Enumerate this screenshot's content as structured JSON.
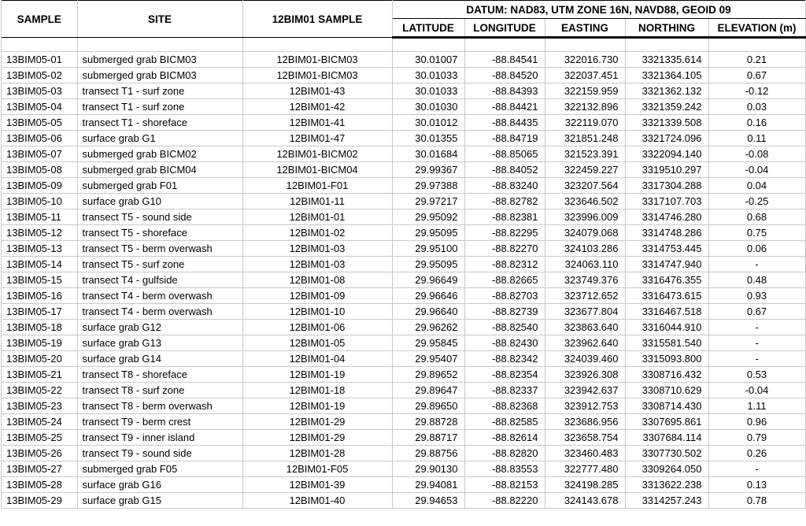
{
  "header": {
    "sample": "SAMPLE",
    "site": "SITE",
    "bim": "12BIM01 SAMPLE",
    "datum_group": "DATUM: NAD83, UTM ZONE 16N, NAVD88, GEOID 09",
    "lat": "LATITUDE",
    "lon": "LONGITUDE",
    "east": "EASTING",
    "north": "NORTHING",
    "elev": "ELEVATION (m)"
  },
  "rows": [
    {
      "sample": "13BIM05-01",
      "site": "submerged grab BICM03",
      "bim": "12BIM01-BICM03",
      "lat": "30.01007",
      "lon": "-88.84541",
      "east": "322016.730",
      "north": "3321335.614",
      "elev": "0.21"
    },
    {
      "sample": "13BIM05-02",
      "site": "submerged grab BICM03",
      "bim": "12BIM01-BICM03",
      "lat": "30.01033",
      "lon": "-88.84520",
      "east": "322037.451",
      "north": "3321364.105",
      "elev": "0.67"
    },
    {
      "sample": "13BIM05-03",
      "site": "transect T1 - surf zone",
      "bim": "12BIM01-43",
      "lat": "30.01033",
      "lon": "-88.84393",
      "east": "322159.959",
      "north": "3321362.132",
      "elev": "-0.12"
    },
    {
      "sample": "13BIM05-04",
      "site": "transect T1 - surf zone",
      "bim": "12BIM01-42",
      "lat": "30.01030",
      "lon": "-88.84421",
      "east": "322132.896",
      "north": "3321359.242",
      "elev": "0.03"
    },
    {
      "sample": "13BIM05-05",
      "site": "transect T1 - shoreface",
      "bim": "12BIM01-41",
      "lat": "30.01012",
      "lon": "-88.84435",
      "east": "322119.070",
      "north": "3321339.508",
      "elev": "0.16"
    },
    {
      "sample": "13BIM05-06",
      "site": "surface grab G1",
      "bim": "12BIM01-47",
      "lat": "30.01355",
      "lon": "-88.84719",
      "east": "321851.248",
      "north": "3321724.096",
      "elev": "0.11"
    },
    {
      "sample": "13BIM05-07",
      "site": "submerged grab BICM02",
      "bim": "12BIM01-BICM02",
      "lat": "30.01684",
      "lon": "-88.85065",
      "east": "321523.391",
      "north": "3322094.140",
      "elev": "-0.08"
    },
    {
      "sample": "13BIM05-08",
      "site": "submerged grab BICM04",
      "bim": "12BIM01-BICM04",
      "lat": "29.99367",
      "lon": "-88.84052",
      "east": "322459.227",
      "north": "3319510.297",
      "elev": "-0.04"
    },
    {
      "sample": "13BIM05-09",
      "site": "submerged grab F01",
      "bim": "12BIM01-F01",
      "lat": "29.97388",
      "lon": "-88.83240",
      "east": "323207.564",
      "north": "3317304.288",
      "elev": "0.04"
    },
    {
      "sample": "13BIM05-10",
      "site": "surface grab G10",
      "bim": "12BIM01-11",
      "lat": "29.97217",
      "lon": "-88.82782",
      "east": "323646.502",
      "north": "3317107.703",
      "elev": "-0.25"
    },
    {
      "sample": "13BIM05-11",
      "site": "transect T5 - sound side",
      "bim": "12BIM01-01",
      "lat": "29.95092",
      "lon": "-88.82381",
      "east": "323996.009",
      "north": "3314746.280",
      "elev": "0.68"
    },
    {
      "sample": "13BIM05-12",
      "site": "transect T5 - shoreface",
      "bim": "12BIM01-02",
      "lat": "29.95095",
      "lon": "-88.82295",
      "east": "324079.068",
      "north": "3314748.286",
      "elev": "0.75"
    },
    {
      "sample": "13BIM05-13",
      "site": "transect T5 - berm overwash",
      "bim": "12BIM01-03",
      "lat": "29.95100",
      "lon": "-88.82270",
      "east": "324103.286",
      "north": "3314753.445",
      "elev": "0.06"
    },
    {
      "sample": "13BIM05-14",
      "site": "transect T5 - surf zone",
      "bim": "12BIM01-03",
      "lat": "29.95095",
      "lon": "-88.82312",
      "east": "324063.110",
      "north": "3314747.940",
      "elev": "-"
    },
    {
      "sample": "13BIM05-15",
      "site": "transect T4 - gulfside",
      "bim": "12BIM01-08",
      "lat": "29.96649",
      "lon": "-88.82665",
      "east": "323749.376",
      "north": "3316476.355",
      "elev": "0.48"
    },
    {
      "sample": "13BIM05-16",
      "site": "transect T4 - berm overwash",
      "bim": "12BIM01-09",
      "lat": "29.96646",
      "lon": "-88.82703",
      "east": "323712.652",
      "north": "3316473.615",
      "elev": "0.93"
    },
    {
      "sample": "13BIM05-17",
      "site": "transect T4 - berm overwash",
      "bim": "12BIM01-10",
      "lat": "29.96640",
      "lon": "-88.82739",
      "east": "323677.804",
      "north": "3316467.518",
      "elev": "0.67"
    },
    {
      "sample": "13BIM05-18",
      "site": "surface grab G12",
      "bim": "12BIM01-06",
      "lat": "29.96262",
      "lon": "-88.82540",
      "east": "323863.640",
      "north": "3316044.910",
      "elev": "-"
    },
    {
      "sample": "13BIM05-19",
      "site": "surface grab G13",
      "bim": "12BIM01-05",
      "lat": "29.95845",
      "lon": "-88.82430",
      "east": "323962.640",
      "north": "3315581.540",
      "elev": "-"
    },
    {
      "sample": "13BIM05-20",
      "site": "surface grab G14",
      "bim": "12BIM01-04",
      "lat": "29.95407",
      "lon": "-88.82342",
      "east": "324039.460",
      "north": "3315093.800",
      "elev": "-"
    },
    {
      "sample": "13BIM05-21",
      "site": "transect T8 - shoreface",
      "bim": "12BIM01-19",
      "lat": "29.89652",
      "lon": "-88.82354",
      "east": "323926.308",
      "north": "3308716.432",
      "elev": "0.53"
    },
    {
      "sample": "13BIM05-22",
      "site": "transect T8 - surf zone",
      "bim": "12BIM01-18",
      "lat": "29.89647",
      "lon": "-88.82337",
      "east": "323942.637",
      "north": "3308710.629",
      "elev": "-0.04"
    },
    {
      "sample": "13BIM05-23",
      "site": "transect T8 - berm overwash",
      "bim": "12BIM01-19",
      "lat": "29.89650",
      "lon": "-88.82368",
      "east": "323912.753",
      "north": "3308714.430",
      "elev": "1.11"
    },
    {
      "sample": "13BIM05-24",
      "site": "transect T9 - berm crest",
      "bim": "12BIM01-29",
      "lat": "29.88728",
      "lon": "-88.82585",
      "east": "323686.956",
      "north": "3307695.861",
      "elev": "0.96"
    },
    {
      "sample": "13BIM05-25",
      "site": "transect T9 - inner island",
      "bim": "12BIM01-29",
      "lat": "29.88717",
      "lon": "-88.82614",
      "east": "323658.754",
      "north": "3307684.114",
      "elev": "0.79"
    },
    {
      "sample": "13BIM05-26",
      "site": "transect T9 - sound side",
      "bim": "12BIM01-28",
      "lat": "29.88756",
      "lon": "-88.82820",
      "east": "323460.483",
      "north": "3307730.502",
      "elev": "0.26"
    },
    {
      "sample": "13BIM05-27",
      "site": "submerged grab  F05",
      "bim": "12BIM01-F05",
      "lat": "29.90130",
      "lon": "-88.83553",
      "east": "322777.480",
      "north": "3309264.050",
      "elev": "-"
    },
    {
      "sample": "13BIM05-28",
      "site": "surface grab G16",
      "bim": "12BIM01-39",
      "lat": "29.94081",
      "lon": "-88.82153",
      "east": "324198.285",
      "north": "3313622.238",
      "elev": "0.13"
    },
    {
      "sample": "13BIM05-29",
      "site": "surface grab G15",
      "bim": "12BIM01-40",
      "lat": "29.94653",
      "lon": "-88.82220",
      "east": "324143.678",
      "north": "3314257.243",
      "elev": "0.78"
    }
  ]
}
